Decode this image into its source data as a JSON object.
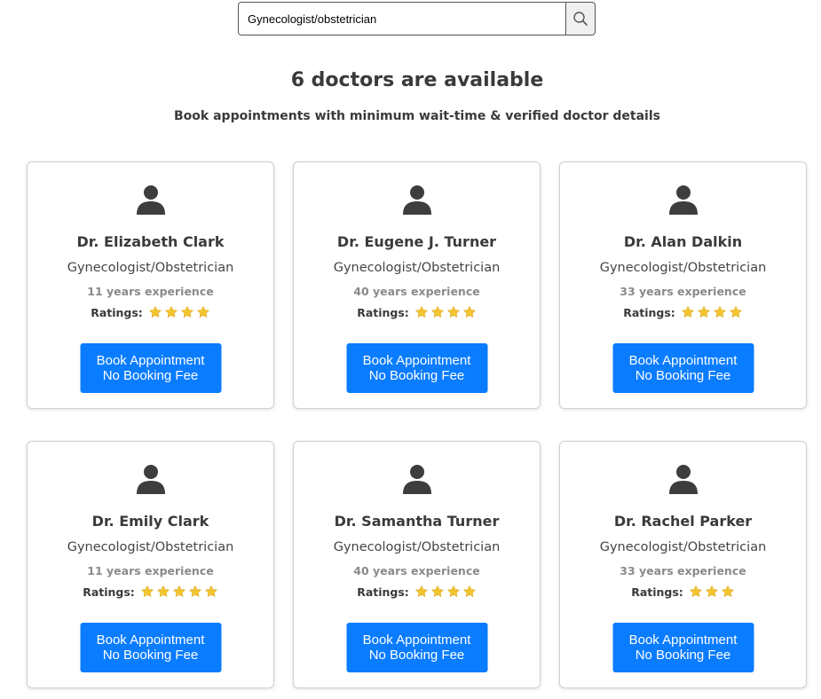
{
  "search": {
    "value": "Gynecologist/obstetrician"
  },
  "heading": "6 doctors are available",
  "subheading": "Book appointments with minimum wait-time & verified doctor details",
  "ratings_label": "Ratings:",
  "book_button": {
    "line1": "Book Appointment",
    "line2": "No Booking Fee"
  },
  "colors": {
    "button": "#0a7cff",
    "star": "#f4c430",
    "text": "#3a3a3a",
    "muted": "#8a8a8a"
  },
  "doctors": [
    {
      "name": "Dr. Elizabeth Clark",
      "speciality": "Gynecologist/Obstetrician",
      "experience": "11 years experience",
      "rating": 4
    },
    {
      "name": "Dr. Eugene J. Turner",
      "speciality": "Gynecologist/Obstetrician",
      "experience": "40 years experience",
      "rating": 4
    },
    {
      "name": "Dr. Alan Dalkin",
      "speciality": "Gynecologist/Obstetrician",
      "experience": "33 years experience",
      "rating": 4
    },
    {
      "name": "Dr. Emily Clark",
      "speciality": "Gynecologist/Obstetrician",
      "experience": "11 years experience",
      "rating": 5
    },
    {
      "name": "Dr. Samantha Turner",
      "speciality": "Gynecologist/Obstetrician",
      "experience": "40 years experience",
      "rating": 4
    },
    {
      "name": "Dr. Rachel Parker",
      "speciality": "Gynecologist/Obstetrician",
      "experience": "33 years experience",
      "rating": 3
    }
  ]
}
